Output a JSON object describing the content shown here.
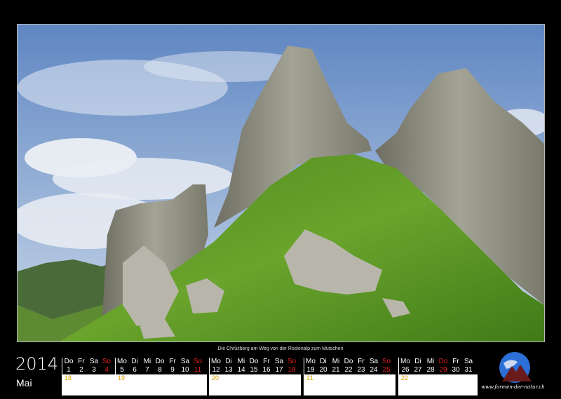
{
  "photo": {
    "caption": "Die Chrüzberg am Weg von der Roslenalp zum Mutschen"
  },
  "calendar": {
    "year": "2014",
    "month": "Mai",
    "weeks": [
      {
        "days": [
          {
            "n": "Do",
            "d": "1"
          },
          {
            "n": "Fr",
            "d": "2"
          },
          {
            "n": "Sa",
            "d": "3"
          },
          {
            "n": "So",
            "d": "4",
            "sunday": true
          }
        ],
        "kw": "18"
      },
      {
        "days": [
          {
            "n": "Mo",
            "d": "5"
          },
          {
            "n": "Di",
            "d": "6"
          },
          {
            "n": "Mi",
            "d": "7"
          },
          {
            "n": "Do",
            "d": "8"
          },
          {
            "n": "Fr",
            "d": "9"
          },
          {
            "n": "Sa",
            "d": "10"
          },
          {
            "n": "So",
            "d": "11",
            "sunday": true
          }
        ],
        "kw": "19"
      },
      {
        "days": [
          {
            "n": "Mo",
            "d": "12"
          },
          {
            "n": "Di",
            "d": "13"
          },
          {
            "n": "Mi",
            "d": "14"
          },
          {
            "n": "Do",
            "d": "15"
          },
          {
            "n": "Fr",
            "d": "16"
          },
          {
            "n": "Sa",
            "d": "17"
          },
          {
            "n": "So",
            "d": "18",
            "sunday": true
          }
        ],
        "kw": "20"
      },
      {
        "days": [
          {
            "n": "Mo",
            "d": "19"
          },
          {
            "n": "Di",
            "d": "20"
          },
          {
            "n": "Mi",
            "d": "21"
          },
          {
            "n": "Do",
            "d": "22"
          },
          {
            "n": "Fr",
            "d": "23"
          },
          {
            "n": "Sa",
            "d": "24"
          },
          {
            "n": "So",
            "d": "25",
            "sunday": true
          }
        ],
        "kw": "21"
      },
      {
        "days": [
          {
            "n": "Mo",
            "d": "26"
          },
          {
            "n": "Di",
            "d": "27"
          },
          {
            "n": "Mi",
            "d": "28"
          },
          {
            "n": "Do",
            "d": "29",
            "sunday": true
          },
          {
            "n": "Fr",
            "d": "30"
          },
          {
            "n": "Sa",
            "d": "31"
          }
        ],
        "kw": "22"
      }
    ]
  },
  "logo": {
    "url": "www.formen-der-natur.ch",
    "icon": "globe-mountain-icon"
  },
  "colors": {
    "background": "#000000",
    "sunday": "#e0201e",
    "week_number": "#e0a000",
    "sky": "#6f93c9",
    "grass": "#5f9a2a",
    "rock": "#8a8a7e"
  }
}
